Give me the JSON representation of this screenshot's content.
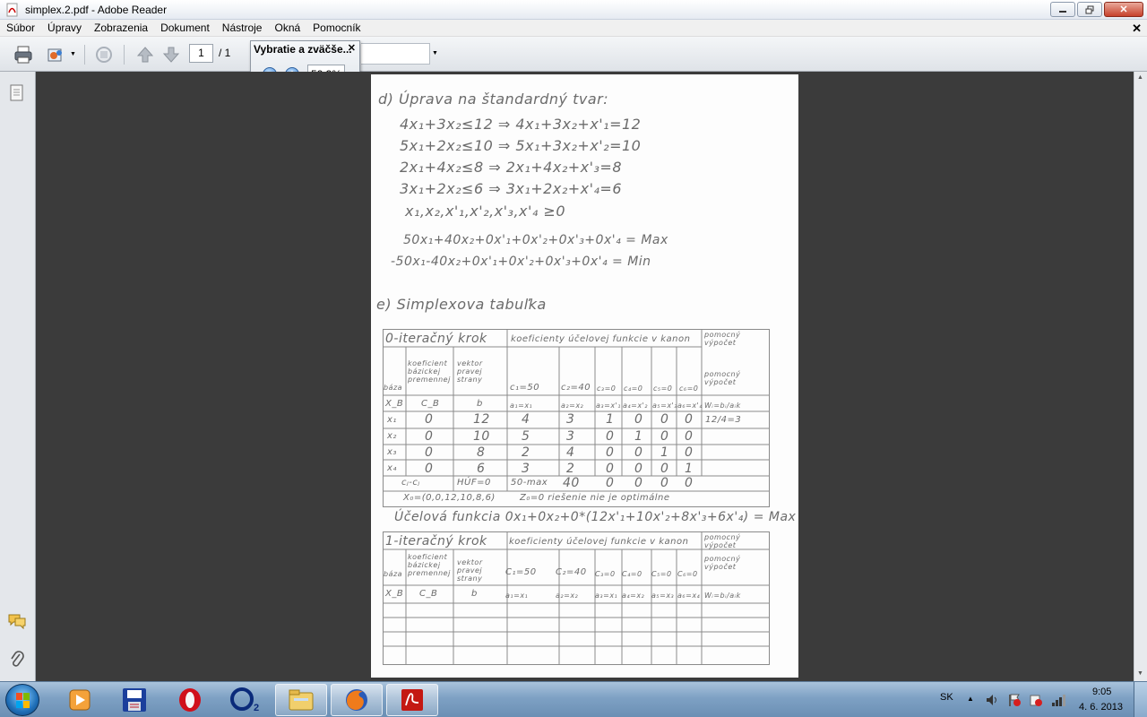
{
  "window": {
    "title": "simplex.2.pdf - Adobe Reader"
  },
  "menu": {
    "items": [
      "Súbor",
      "Úpravy",
      "Zobrazenia",
      "Dokument",
      "Nástroje",
      "Okná",
      "Pomocník"
    ]
  },
  "toolbar": {
    "page_current": "1",
    "page_total": "/ 1"
  },
  "zoom_popup": {
    "title": "Vybratie a zväčše...",
    "zoom_value": "52,3%"
  },
  "document": {
    "lines": [
      "d) Úprava na štandardný tvar:",
      "4x₁+3x₂≤12 ⇒ 4x₁+3x₂+x'₁=12",
      "5x₁+2x₂≤10 ⇒ 5x₁+3x₂+x'₂=10",
      "2x₁+4x₂≤8 ⇒ 2x₁+4x₂+x'₃=8",
      "3x₁+2x₂≤6 ⇒ 3x₁+2x₂+x'₄=6",
      "x₁,x₂,x'₁,x'₂,x'₃,x'₄ ≥0",
      "50x₁+40x₂+0x'₁+0x'₂+0x'₃+0x'₄ = Max",
      "-50x₁-40x₂+0x'₁+0x'₂+0x'₃+0x'₄ = Min",
      "e) Simplexova tabuľka",
      "X₀=(0,0,12,10,8,6)",
      "Z₀=0 riešenie nie je optimálne",
      "Účelová funkcia 0x₁+0x₂+0*(12x'₁+10x'₂+8x'₃+6x'₄) = Max"
    ],
    "table1": {
      "header_left": "0-iteračný krok",
      "header_mid": "koeficienty účelovej funkcie v kanonickom tvare",
      "header_right": "pomocný výpočet",
      "sub_headers": [
        "báza",
        "koeficient bázickej premennej",
        "vektor pravej strany",
        "c₁=50",
        "c₂=40",
        "c₃=0",
        "c₄=0",
        "c₅=0",
        "c₆=0",
        "pomocný výpočet"
      ],
      "row_keys": [
        "X_B",
        "C_B",
        "b",
        "a₁=x₁",
        "a₂=x₂",
        "a₃=x'₁",
        "a₄=x'₂",
        "a₅=x'₃",
        "a₆=x'₄",
        "Wᵢ=bᵢ/aᵢk"
      ],
      "rows": [
        [
          "x₁",
          "0",
          "12",
          "4",
          "3",
          "1",
          "0",
          "0",
          "0",
          "12/4=3"
        ],
        [
          "x₂",
          "0",
          "10",
          "5",
          "3",
          "0",
          "1",
          "0",
          "0",
          ""
        ],
        [
          "x₃",
          "0",
          "8",
          "2",
          "4",
          "0",
          "0",
          "1",
          "0",
          ""
        ],
        [
          "x₄",
          "0",
          "6",
          "3",
          "2",
          "0",
          "0",
          "0",
          "1",
          ""
        ]
      ],
      "cj_row": [
        "cⱼ-cⱼ",
        "HÚF=0",
        "50-max",
        "40",
        "0",
        "0",
        "0",
        "0"
      ]
    },
    "table2": {
      "header_left": "1-iteračný krok",
      "header_mid": "koeficienty účelovej funkcie v kanonickom tvare",
      "header_right": "pomocný výpočet",
      "sub_headers": [
        "báza",
        "koeficient bázickej premennej",
        "vektor pravej strany",
        "C₁=50",
        "C₂=40",
        "C₃=0",
        "C₄=0",
        "C₅=0",
        "C₆=0",
        "pomocný výpočet"
      ],
      "row_keys": [
        "X_B",
        "C_B",
        "b",
        "a₁=x₁",
        "a₂=x₂",
        "a₃=x₁",
        "a₄=x₂",
        "a₅=x₃",
        "a₆=x₄",
        "Wᵢ=bᵢ/aᵢk"
      ]
    }
  },
  "taskbar": {
    "language": "SK",
    "time": "9:05",
    "date": "4. 6. 2013",
    "apps": [
      "media-player-icon",
      "save-app-icon",
      "opera-icon",
      "o2-icon",
      "file-explorer-icon",
      "firefox-icon",
      "adobe-reader-icon"
    ]
  }
}
